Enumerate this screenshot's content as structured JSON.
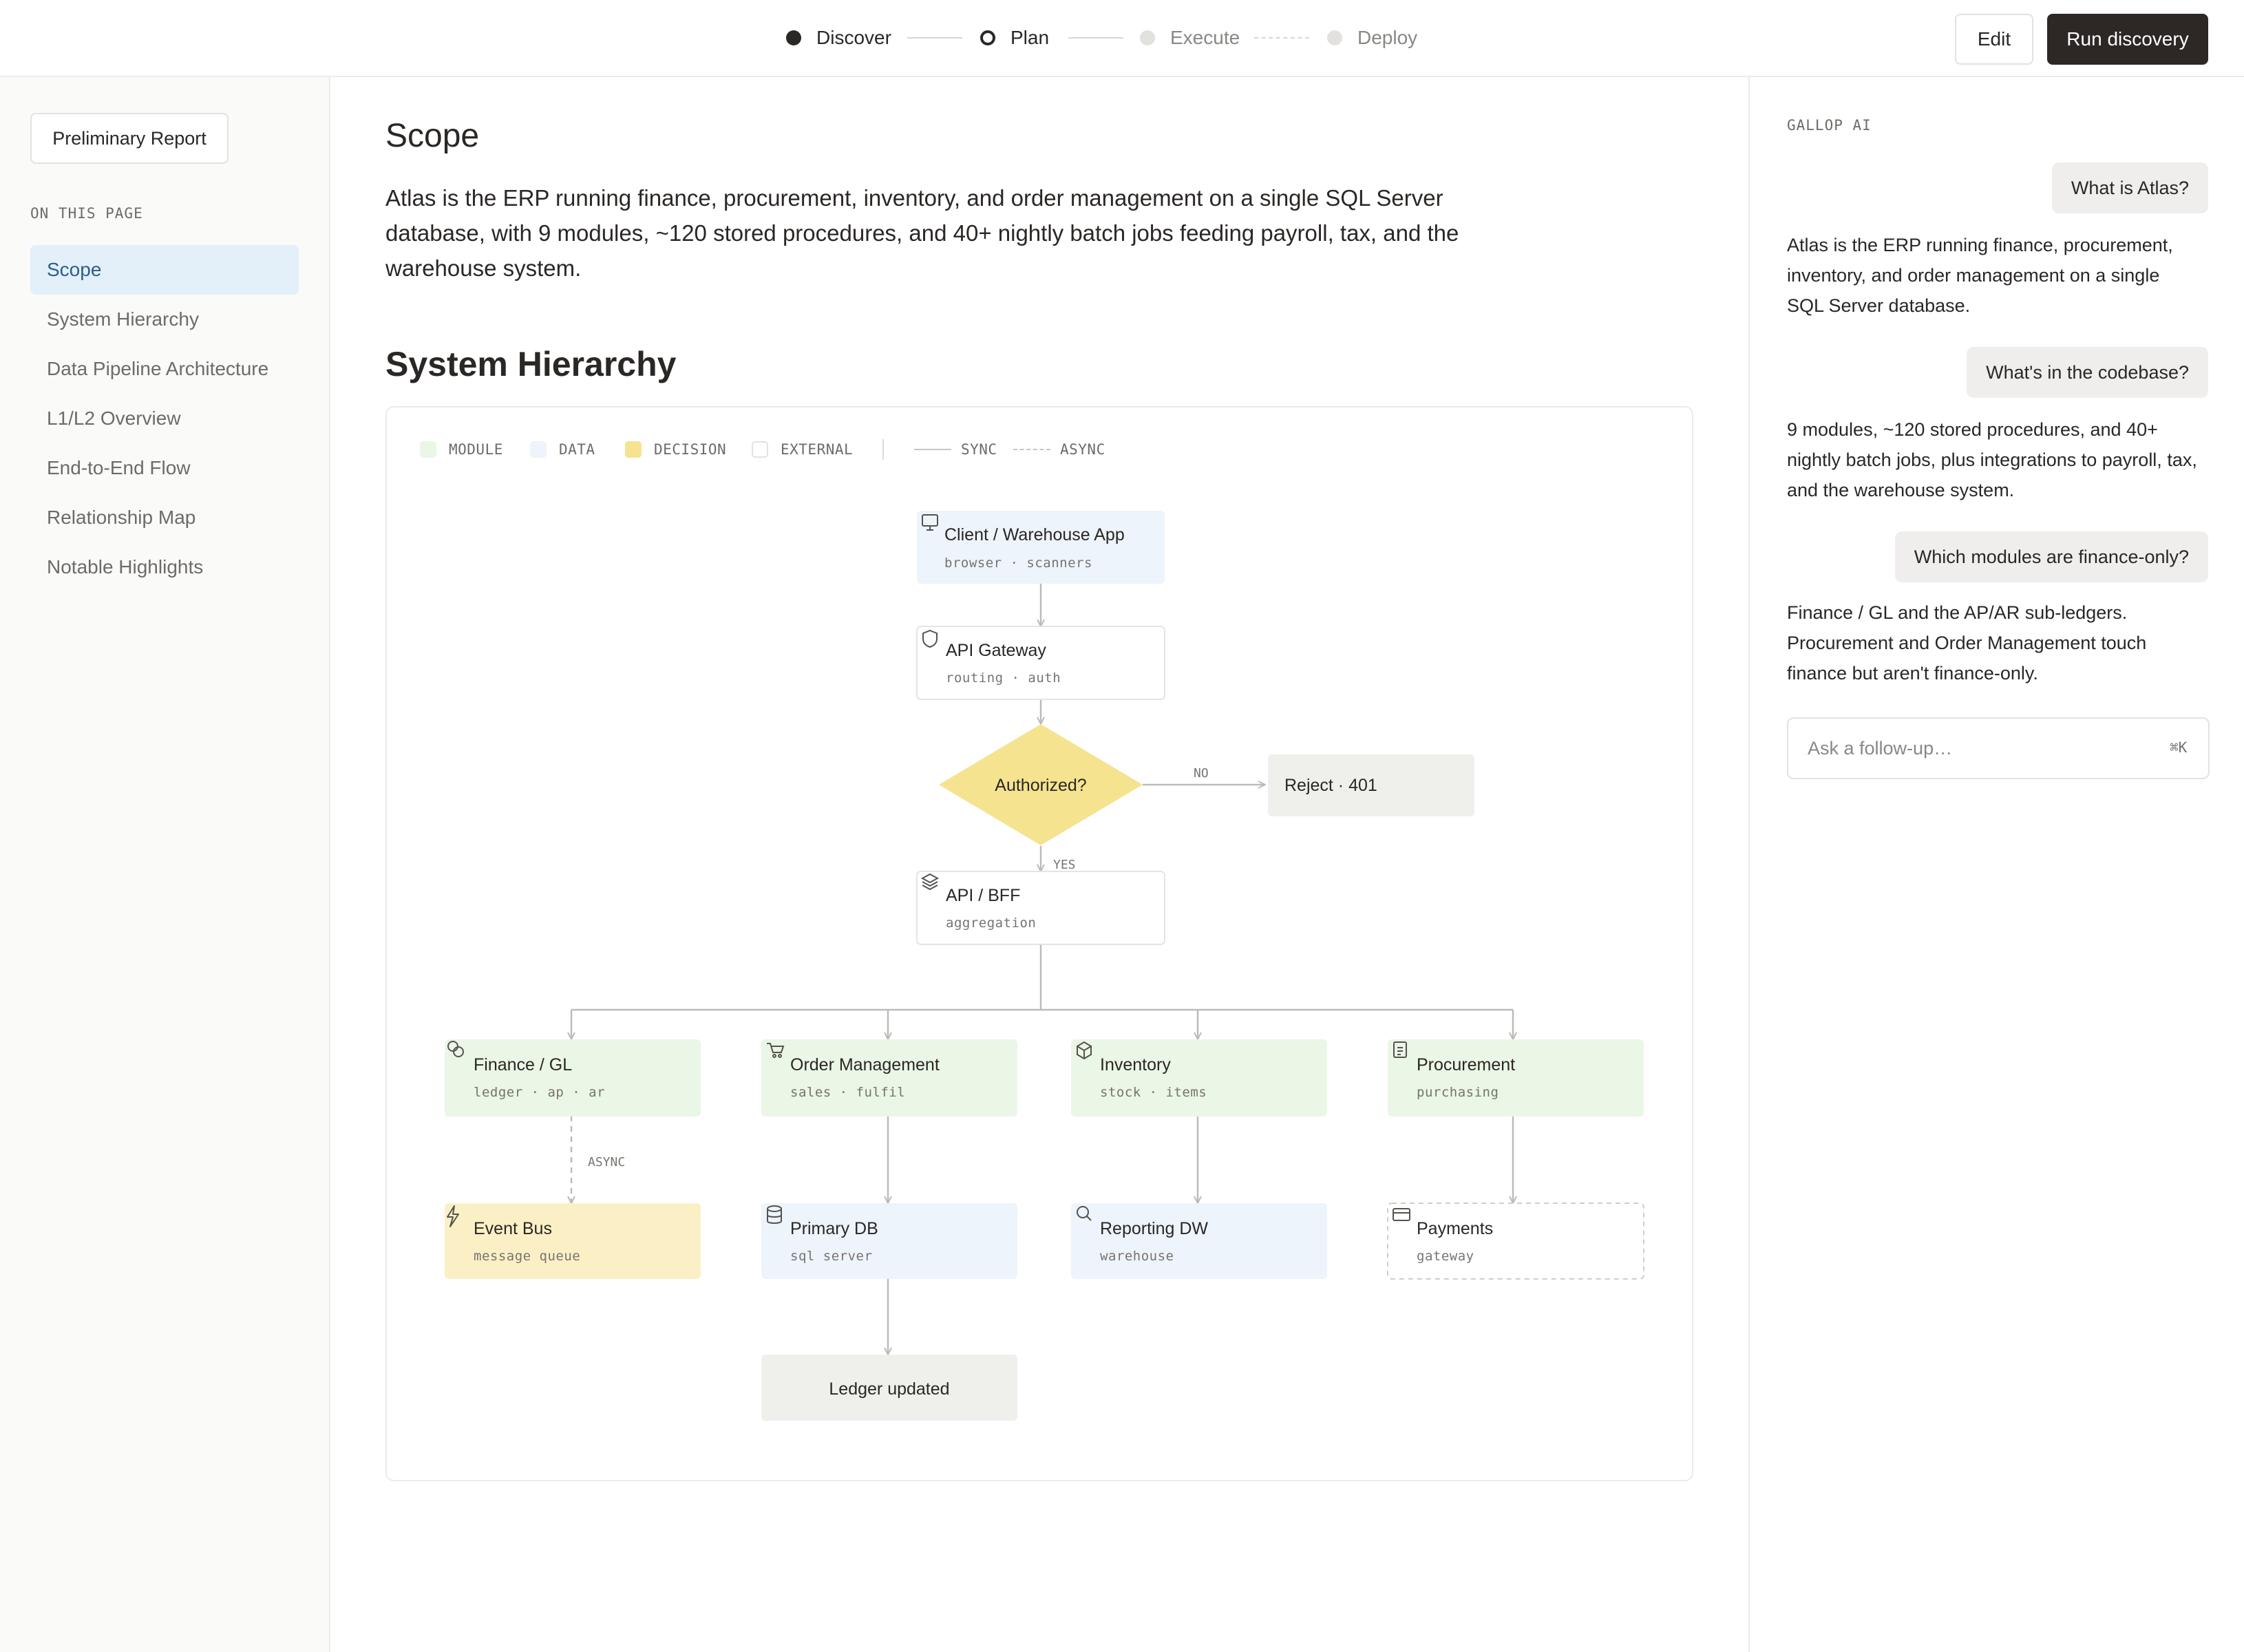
{
  "stepper": {
    "steps": [
      {
        "label": "Discover",
        "state": "done"
      },
      {
        "label": "Plan",
        "state": "current"
      },
      {
        "label": "Execute",
        "state": "todo"
      },
      {
        "label": "Deploy",
        "state": "todo"
      }
    ]
  },
  "toolbar": {
    "edit_label": "Edit",
    "run_label": "Run discovery"
  },
  "sidebar": {
    "report_button": "Preliminary Report",
    "section_label": "ON THIS PAGE",
    "items": [
      {
        "label": "Scope",
        "active": true
      },
      {
        "label": "System Hierarchy",
        "active": false
      },
      {
        "label": "Data Pipeline Architecture",
        "active": false
      },
      {
        "label": "L1/L2 Overview",
        "active": false
      },
      {
        "label": "End-to-End Flow",
        "active": false
      },
      {
        "label": "Relationship Map",
        "active": false
      },
      {
        "label": "Notable Highlights",
        "active": false
      }
    ]
  },
  "main": {
    "scope_title": "Scope",
    "scope_text": "Atlas is the ERP running finance, procurement, inventory, and order management on a single SQL Server database, with 9 modules, ~120 stored procedures, and 40+ nightly batch jobs feeding payroll, tax, and the warehouse system.",
    "hierarchy_title": "System Hierarchy"
  },
  "legend": {
    "module": "MODULE",
    "data": "DATA",
    "decision": "DECISION",
    "external": "EXTERNAL",
    "sync": "SYNC",
    "async": "ASYNC"
  },
  "colors": {
    "module": "#eaf6e6",
    "data": "#edf4fb",
    "decision": "#f5e38f",
    "event": "#fbf0c5",
    "terminal": "#efefeb",
    "external": "#ffffff",
    "edge": "#bdbbb7",
    "active_nav": "#e3eff9",
    "primary_button": "#2d2826"
  },
  "diagram": {
    "nodes": {
      "client": {
        "title": "Client / Warehouse App",
        "sub": "browser · scanners",
        "icon": "monitor-icon"
      },
      "gateway": {
        "title": "API Gateway",
        "sub": "routing · auth",
        "icon": "shield-icon"
      },
      "authorized": {
        "title": "Authorized?"
      },
      "reject": {
        "title": "Reject · 401"
      },
      "bff": {
        "title": "API / BFF",
        "sub": "aggregation",
        "icon": "layers-icon"
      },
      "finance": {
        "title": "Finance / GL",
        "sub": "ledger · ap · ar",
        "icon": "coins-icon"
      },
      "orders": {
        "title": "Order Management",
        "sub": "sales · fulfil",
        "icon": "cart-icon"
      },
      "inventory": {
        "title": "Inventory",
        "sub": "stock · items",
        "icon": "box-icon"
      },
      "procurement": {
        "title": "Procurement",
        "sub": "purchasing",
        "icon": "clipboard-icon"
      },
      "eventbus": {
        "title": "Event Bus",
        "sub": "message queue",
        "icon": "bolt-icon"
      },
      "primarydb": {
        "title": "Primary DB",
        "sub": "sql server",
        "icon": "database-icon"
      },
      "reporting": {
        "title": "Reporting DW",
        "sub": "warehouse",
        "icon": "search-icon"
      },
      "payments": {
        "title": "Payments",
        "sub": "gateway",
        "icon": "card-icon"
      },
      "ledger": {
        "title": "Ledger updated"
      }
    },
    "edge_labels": {
      "no": "NO",
      "yes": "YES",
      "async": "ASYNC"
    }
  },
  "chat": {
    "label": "GALLOP AI",
    "messages": [
      {
        "role": "user",
        "text": "What is Atlas?"
      },
      {
        "role": "assistant",
        "text": "Atlas is the ERP running finance, procurement, inventory, and order management on a single SQL Server database."
      },
      {
        "role": "user",
        "text": "What's in the codebase?"
      },
      {
        "role": "assistant",
        "text": "9 modules, ~120 stored procedures, and 40+ nightly batch jobs, plus integrations to payroll, tax, and the warehouse system."
      },
      {
        "role": "user",
        "text": "Which modules are finance-only?"
      },
      {
        "role": "assistant",
        "text": "Finance / GL and the AP/AR sub-ledgers. Procurement and Order Management touch finance but aren't finance-only."
      }
    ],
    "input_placeholder": "Ask a follow-up…",
    "shortcut": "⌘K"
  }
}
